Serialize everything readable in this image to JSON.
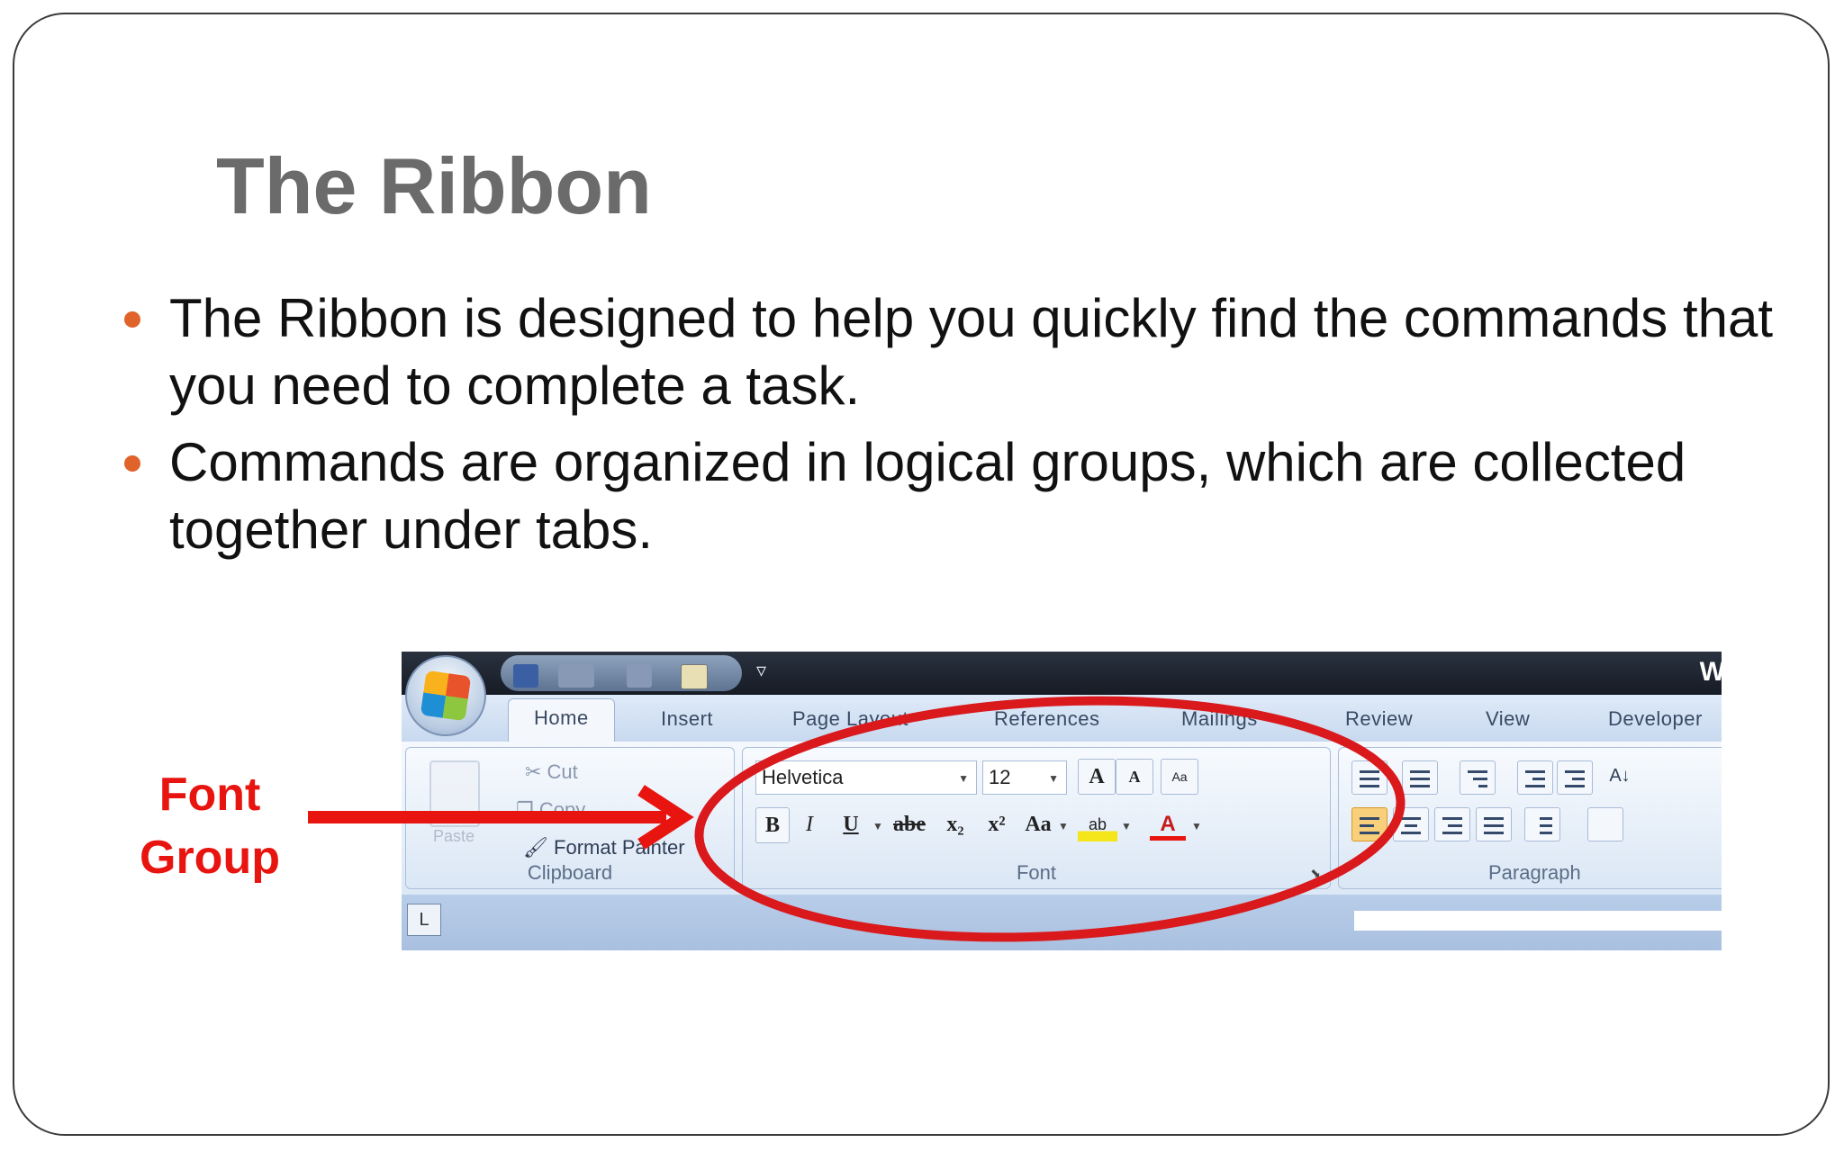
{
  "slide": {
    "title": "The Ribbon",
    "bullets": [
      "The Ribbon is designed to help you quickly find the commands that you need to complete a task.",
      "Commands are organized in logical groups, which are collected together under tabs."
    ],
    "callout": {
      "line1": "Font",
      "line2": "Group"
    },
    "colors": {
      "title": "#6b6b6b",
      "bullet": "#e0632a",
      "callout": "#e8140f",
      "ellipse": "#d9191c"
    }
  },
  "ribbon": {
    "title_glyph": "W",
    "qat_more": "▿",
    "tabs": [
      "Home",
      "Insert",
      "Page Layout",
      "References",
      "Mailings",
      "Review",
      "View",
      "Developer"
    ],
    "active_tab": "Home",
    "clipboard": {
      "paste_label": "Paste",
      "cut": "Cut",
      "copy": "Copy",
      "format_painter": "Format Painter",
      "label": "Clipboard"
    },
    "font": {
      "font_name": "Helvetica",
      "font_size": "12",
      "grow": "A",
      "shrink": "A",
      "clear": "Aa",
      "bold": "B",
      "italic": "I",
      "underline": "U",
      "strike": "abe",
      "subscript": "x₂",
      "superscript": "x²",
      "change_case": "Aa",
      "highlight": "ab",
      "font_color": "A",
      "label": "Font"
    },
    "paragraph": {
      "label": "Paragraph",
      "sort": "A↓"
    },
    "ruler_button": "L"
  }
}
